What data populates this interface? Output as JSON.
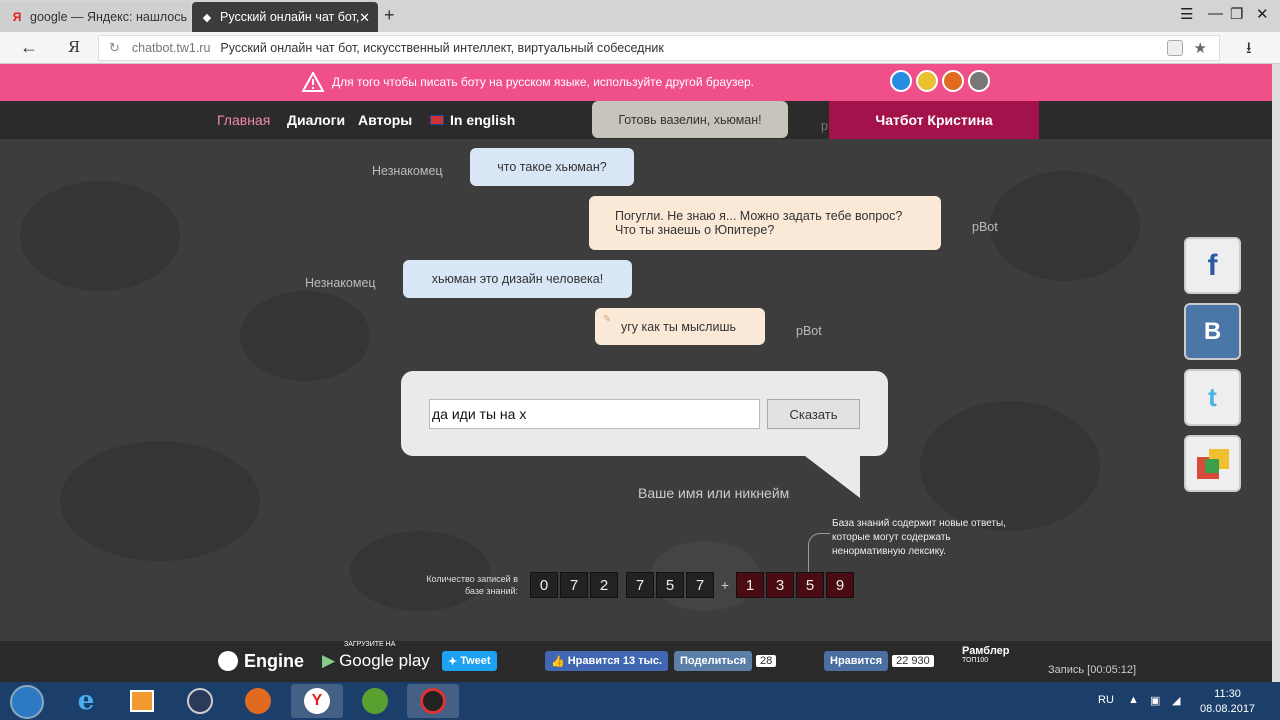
{
  "browser": {
    "tabs": [
      {
        "label": "google — Яндекс: нашлось"
      },
      {
        "label": "Русский онлайн чат бот,"
      }
    ],
    "new_tab_icon": "plus-icon",
    "address": {
      "domain": "chatbot.tw1.ru",
      "page_title": "Русский онлайн чат бот, искусственный интеллект, виртуальный собеседник"
    },
    "yandex_label": "Я"
  },
  "warning": {
    "text": "Для того чтобы писать боту на русском языке, используйте другой браузер."
  },
  "nav": {
    "items": [
      "Главная",
      "Диалоги",
      "Авторы",
      "In english"
    ],
    "bot_button": "Чатбот Кристина",
    "partial_label": "p"
  },
  "chat": {
    "top_bubble": "Готовь вазелин, хьюман!",
    "messages": [
      {
        "who": "Незнакомец",
        "text": "что такое хьюман?"
      },
      {
        "who": "pBot",
        "text1": "Погугли. Не знаю я... Можно задать тебе вопрос?",
        "text2": "Что ты знаешь о Юпитере?"
      },
      {
        "who": "Незнакомец",
        "text": "хьюман это дизайн человека!"
      },
      {
        "who": "pBot",
        "text": "угу как ты мыслишь"
      }
    ]
  },
  "form": {
    "input_value": "да иди ты на х",
    "say_button": "Сказать",
    "nick_label": "Ваше имя или никнейм"
  },
  "knowledge": {
    "note": "База знаний содержит новые ответы, которые могут содержать ненормативную лексику.",
    "label": "Количество записей в базе знаний:",
    "base_digits": [
      "0",
      "7",
      "2",
      "7",
      "5",
      "7"
    ],
    "plus": "+",
    "new_digits": [
      "1",
      "3",
      "5",
      "9"
    ]
  },
  "footer": {
    "engine": "Engine",
    "gplay_small": "ЗАГРУЗИТЕ НА",
    "gplay": "Google play",
    "tweet": "Tweet",
    "fb_like": "Нравится 13 тыс.",
    "vk_share": "Поделиться",
    "vk_count": "28",
    "ok_like": "Нравится",
    "ok_count": "22 930",
    "rambler": "Рамблер",
    "rambler_sub": "ТОП100"
  },
  "recording": "Запись [00:05:12]",
  "taskbar": {
    "lang": "RU",
    "time": "11:30",
    "date": "08.08.2017"
  },
  "colors": {
    "warning_bar": "#f0508a",
    "bot_button": "#a3124a",
    "active_nav": "#f08aa8"
  }
}
